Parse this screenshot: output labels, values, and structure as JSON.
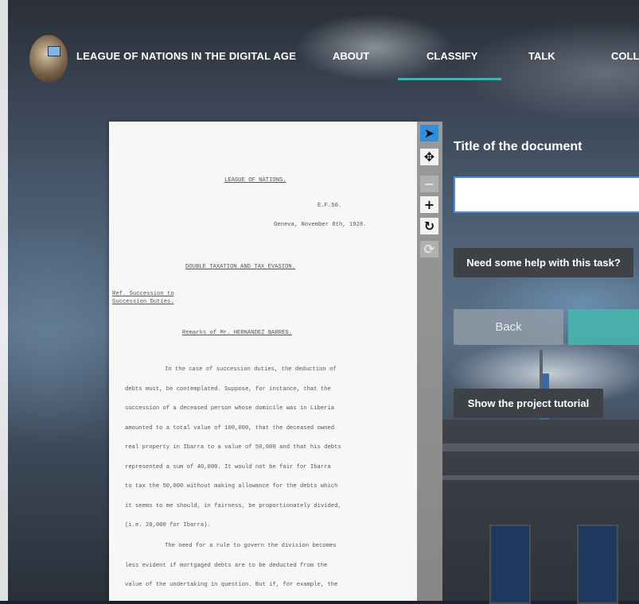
{
  "header": {
    "site_title": "LEAGUE OF NATIONS IN THE DIGITAL AGE",
    "nav": [
      {
        "label": "ABOUT",
        "active": false
      },
      {
        "label": "CLASSIFY",
        "active": true
      },
      {
        "label": "TALK",
        "active": false
      },
      {
        "label": "COLL",
        "active": false
      }
    ],
    "accent_color": "#3fb3b3"
  },
  "document": {
    "heading": "LEAGUE OF NATIONS.",
    "ref": "E.F.50.",
    "place_date": "Geneva, November 8th, 1928.",
    "subject": "DOUBLE TAXATION AND TAX EVASION.",
    "margin_note_1": "Ref. Succession to",
    "margin_note_2": "Succession Duties.",
    "remarks_title": "Remarks of Mr. HERNANDEZ BARRES.",
    "para1_lines": [
      "In the case of succession duties, the deduction of",
      "debts must, be contemplated. Suppose, for instance, that the",
      "succession of a deceased person whose domicile was in Liberia",
      "amounted to a total value of 100,000, that the deceased owned",
      "real property in Ibarra to a value of 50,000 and that his debts",
      "represented a sum of 40,000. It would not be fair for Ibarra",
      "to tax the 50,000 without making allowance for the debts which",
      "it seems to me should, in fairness, be proportionately divided,",
      "(i.e. 20,000 for Ibarra)."
    ],
    "para2_lines": [
      "The need for a rule to govern the division becomes",
      "less evident if mortgaged debts are to be deducted from the",
      "value of the undertaking in question. But if, for example, the"
    ]
  },
  "toolbar": {
    "tools": [
      {
        "icon": "pointer-icon",
        "glyph": "➤",
        "state": "active"
      },
      {
        "icon": "move-icon",
        "glyph": "✥",
        "state": "normal"
      },
      {
        "icon": "zoom-out-icon",
        "glyph": "−",
        "state": "dim"
      },
      {
        "icon": "zoom-in-icon",
        "glyph": "+",
        "state": "normal"
      },
      {
        "icon": "rotate-icon",
        "glyph": "↻",
        "state": "normal"
      },
      {
        "icon": "reset-icon",
        "glyph": "⟳",
        "state": "dim"
      }
    ]
  },
  "task": {
    "question": "Title of the document",
    "input_value": "",
    "help_label": "Need some help with this task?",
    "back_label": "Back",
    "tutorial_label": "Show the project tutorial"
  }
}
